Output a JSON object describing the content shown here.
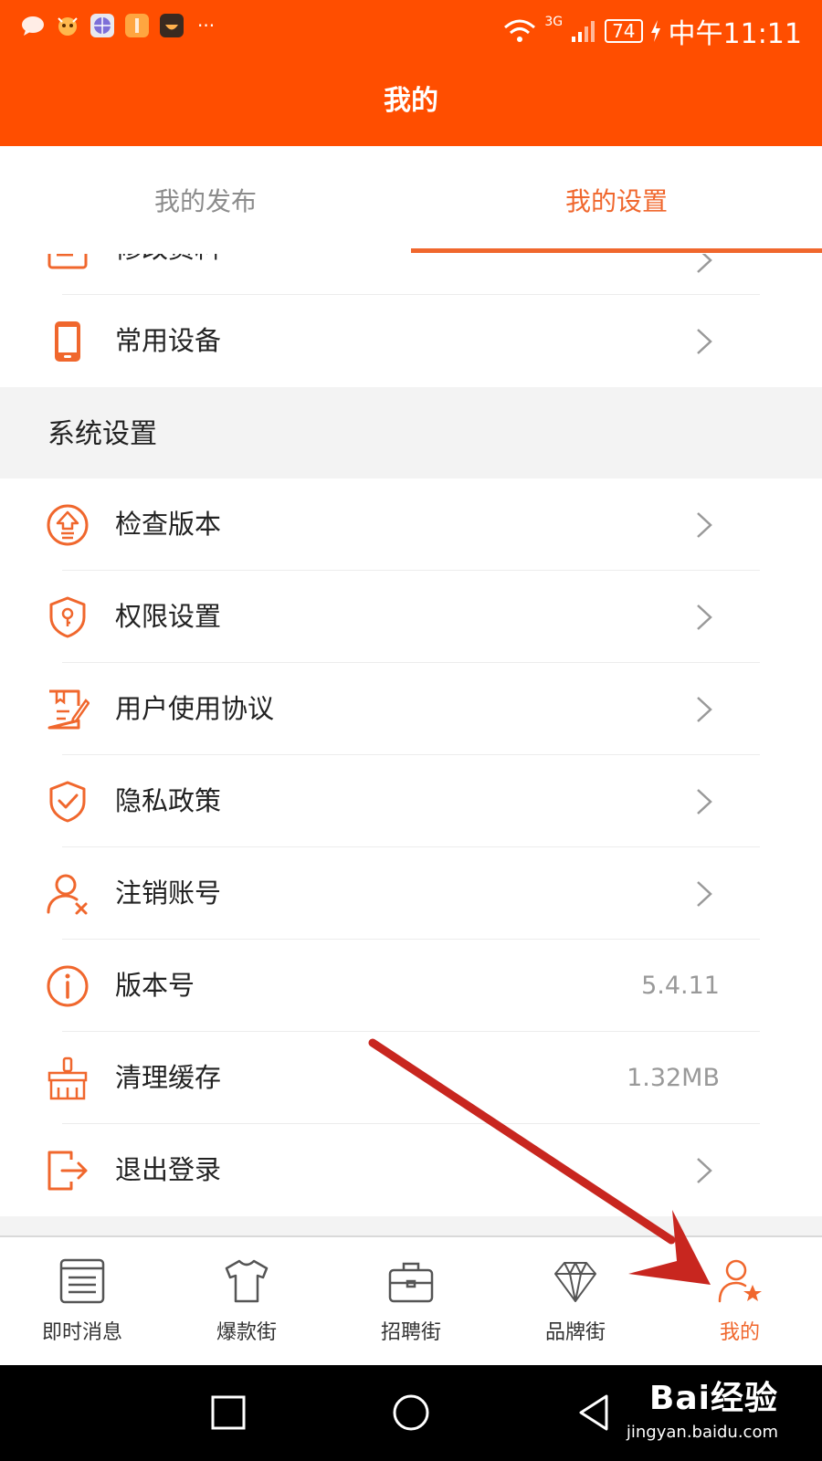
{
  "status_bar": {
    "network": "3G",
    "battery": "74",
    "time": "中午11:11",
    "more": "···"
  },
  "header": {
    "title": "我的"
  },
  "tabs": [
    {
      "label": "我的发布",
      "active": false
    },
    {
      "label": "我的设置",
      "active": true
    }
  ],
  "account_rows": [
    {
      "label": "修改资料",
      "icon": "edit-profile-icon"
    },
    {
      "label": "常用设备",
      "icon": "phone-device-icon"
    }
  ],
  "system_section": {
    "title": "系统设置",
    "rows": [
      {
        "label": "检查版本",
        "icon": "upgrade-icon"
      },
      {
        "label": "权限设置",
        "icon": "shield-key-icon"
      },
      {
        "label": "用户使用协议",
        "icon": "agreement-icon"
      },
      {
        "label": "隐私政策",
        "icon": "shield-check-icon"
      },
      {
        "label": "注销账号",
        "icon": "user-remove-icon"
      },
      {
        "label": "版本号",
        "icon": "info-icon",
        "value": "5.4.11"
      },
      {
        "label": "清理缓存",
        "icon": "broom-icon",
        "value": "1.32MB"
      },
      {
        "label": "退出登录",
        "icon": "logout-icon"
      }
    ]
  },
  "bottom_nav": [
    {
      "label": "即时消息",
      "icon": "message-list-icon",
      "active": false
    },
    {
      "label": "爆款街",
      "icon": "tshirt-icon",
      "active": false
    },
    {
      "label": "招聘街",
      "icon": "briefcase-icon",
      "active": false
    },
    {
      "label": "品牌街",
      "icon": "diamond-icon",
      "active": false
    },
    {
      "label": "我的",
      "icon": "user-star-icon",
      "active": true
    }
  ],
  "watermark": {
    "logo": "Bai经验",
    "url": "jingyan.baidu.com"
  },
  "colors": {
    "brand": "#ff4e00",
    "accent": "#f0672d",
    "annotation_arrow": "#c8261f"
  }
}
